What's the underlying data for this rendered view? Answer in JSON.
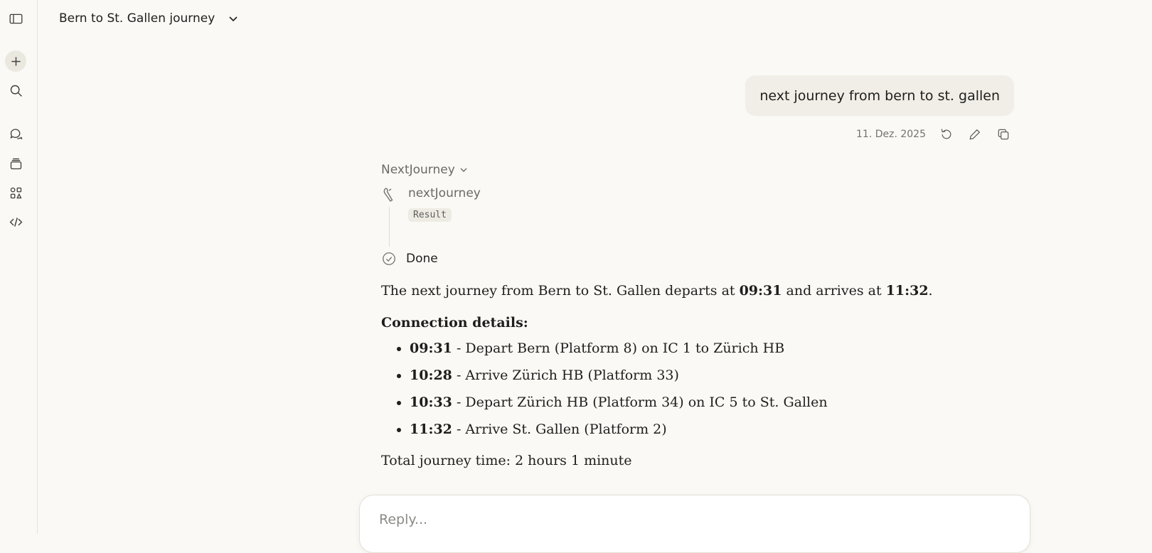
{
  "app": {
    "conversation_title": "Bern to St. Gallen journey"
  },
  "sidebar": {
    "icons": [
      "sidebar-toggle-icon",
      "new-chat-icon",
      "search-icon",
      "chats-icon",
      "projects-icon",
      "artifacts-icon",
      "code-icon"
    ]
  },
  "user_message": {
    "text": "next journey from bern to st. gallen",
    "date": "11. Dez. 2025"
  },
  "assistant": {
    "tool_group_label": "NextJourney",
    "tool_name": "nextJourney",
    "result_label": "Result",
    "done_label": "Done",
    "summary": {
      "prefix": "The next journey from Bern to St. Gallen departs at ",
      "depart": "09:31",
      "middle": " and arrives at ",
      "arrive": "11:32",
      "suffix": "."
    },
    "details_heading": "Connection details:",
    "details": [
      {
        "time": "09:31",
        "text": " - Depart Bern (Platform 8) on IC 1 to Zürich HB"
      },
      {
        "time": "10:28",
        "text": " - Arrive Zürich HB (Platform 33)"
      },
      {
        "time": "10:33",
        "text": " - Depart Zürich HB (Platform 34) on IC 5 to St. Gallen"
      },
      {
        "time": "11:32",
        "text": " - Arrive St. Gallen (Platform 2)"
      }
    ],
    "total": "Total journey time: 2 hours 1 minute"
  },
  "composer": {
    "placeholder": "Reply..."
  }
}
